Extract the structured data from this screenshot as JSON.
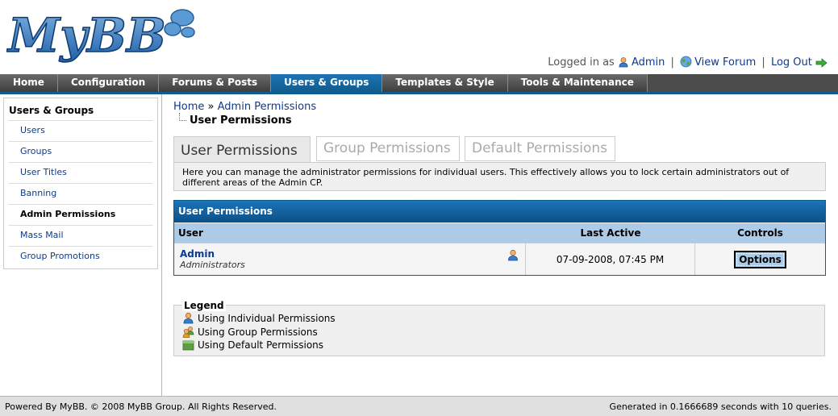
{
  "header": {
    "logo_text": "MyBB",
    "logged_in_as": "Logged in as",
    "username": "Admin",
    "view_forum": "View Forum",
    "log_out": "Log Out",
    "separator": "|"
  },
  "menu": {
    "items": [
      "Home",
      "Configuration",
      "Forums & Posts",
      "Users & Groups",
      "Templates & Style",
      "Tools & Maintenance"
    ],
    "active": "Users & Groups"
  },
  "sidebar": {
    "title": "Users & Groups",
    "items": [
      "Users",
      "Groups",
      "User Titles",
      "Banning",
      "Admin Permissions",
      "Mass Mail",
      "Group Promotions"
    ],
    "active": "Admin Permissions"
  },
  "breadcrumb": {
    "home": "Home",
    "separator": "»",
    "current": "Admin Permissions"
  },
  "page_subtitle": "User Permissions",
  "tabs": [
    "User Permissions",
    "Group Permissions",
    "Default Permissions"
  ],
  "description": "Here you can manage the administrator permissions for individual users. This effectively allows you to lock certain administrators out of different areas of the Admin CP.",
  "table": {
    "title": "User Permissions",
    "columns": [
      "User",
      "Last Active",
      "Controls"
    ],
    "rows": [
      {
        "user": "Admin",
        "group": "Administrators",
        "last_active": "07-09-2008, 07:45 PM",
        "control": "Options"
      }
    ]
  },
  "legend": {
    "title": "Legend",
    "items": [
      "Using Individual Permissions",
      "Using Group Permissions",
      "Using Default Permissions"
    ]
  },
  "footer": {
    "powered": "Powered By MyBB. © 2008 MyBB Group. All Rights Reserved.",
    "generated": "Generated in 0.1666689 seconds with 10 queries."
  },
  "colors": {
    "menu_active": "#0f5c8e",
    "menu_bg": "#4c4c4c",
    "table_header": "#0b5088",
    "column_header": "#adcbe7",
    "link": "#0f3a8a"
  },
  "icons": {
    "user": "user-icon",
    "globe": "globe-icon",
    "logout_arrow": "arrow-right-icon",
    "group": "group-icon",
    "default": "default-permissions-icon"
  }
}
